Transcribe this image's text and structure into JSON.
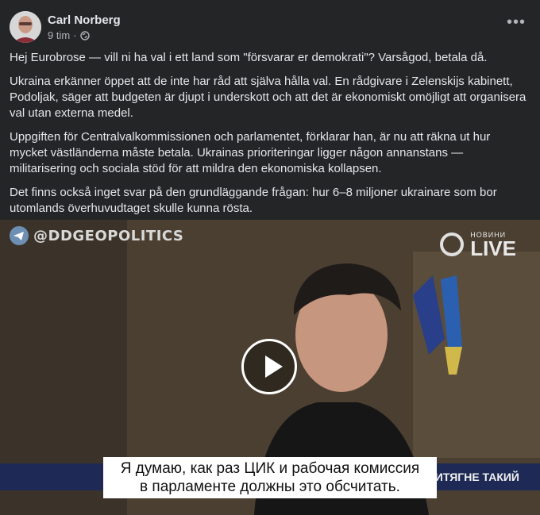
{
  "post": {
    "author": "Carl Norberg",
    "time": "9 tim",
    "separator": "·",
    "more_label": "•••",
    "paragraphs": [
      "Hej Eurobrose — vill ni ha val i ett land som \"försvarar er demokrati\"? Varsågod, betala då.",
      "Ukraina erkänner öppet att de inte har råd att själva hålla val. En rådgivare i Zelenskijs kabinett, Podoljak, säger att budgeten är djupt i underskott och att det är ekonomiskt omöjligt att organisera val utan externa medel.",
      "Uppgiften för Centralvalkommissionen och parlamentet, förklarar han, är nu att räkna ut hur mycket västländerna måste betala. Ukrainas prioriteringar ligger någon annanstans — militarisering och sociala stöd för att mildra den ekonomiska kollapsen.",
      "Det finns också inget svar på den grundläggande frågan: hur 6–8 miljoner ukrainare som bor utomlands överhuvudtaget skulle kunna rösta."
    ]
  },
  "video": {
    "watermark": "@DDGEOPOLITICS",
    "live_small": "НОВИНИ",
    "live_big": "LIVE",
    "ticker": "ИТЯГНЕ ТАКИЙ",
    "subtitle_line1": "Я думаю, как раз ЦИК и рабочая комиссия",
    "subtitle_line2": "в парламенте должны это обсчитать."
  },
  "icons": [
    "globe-icon",
    "telegram-icon",
    "play-icon",
    "more-icon"
  ]
}
